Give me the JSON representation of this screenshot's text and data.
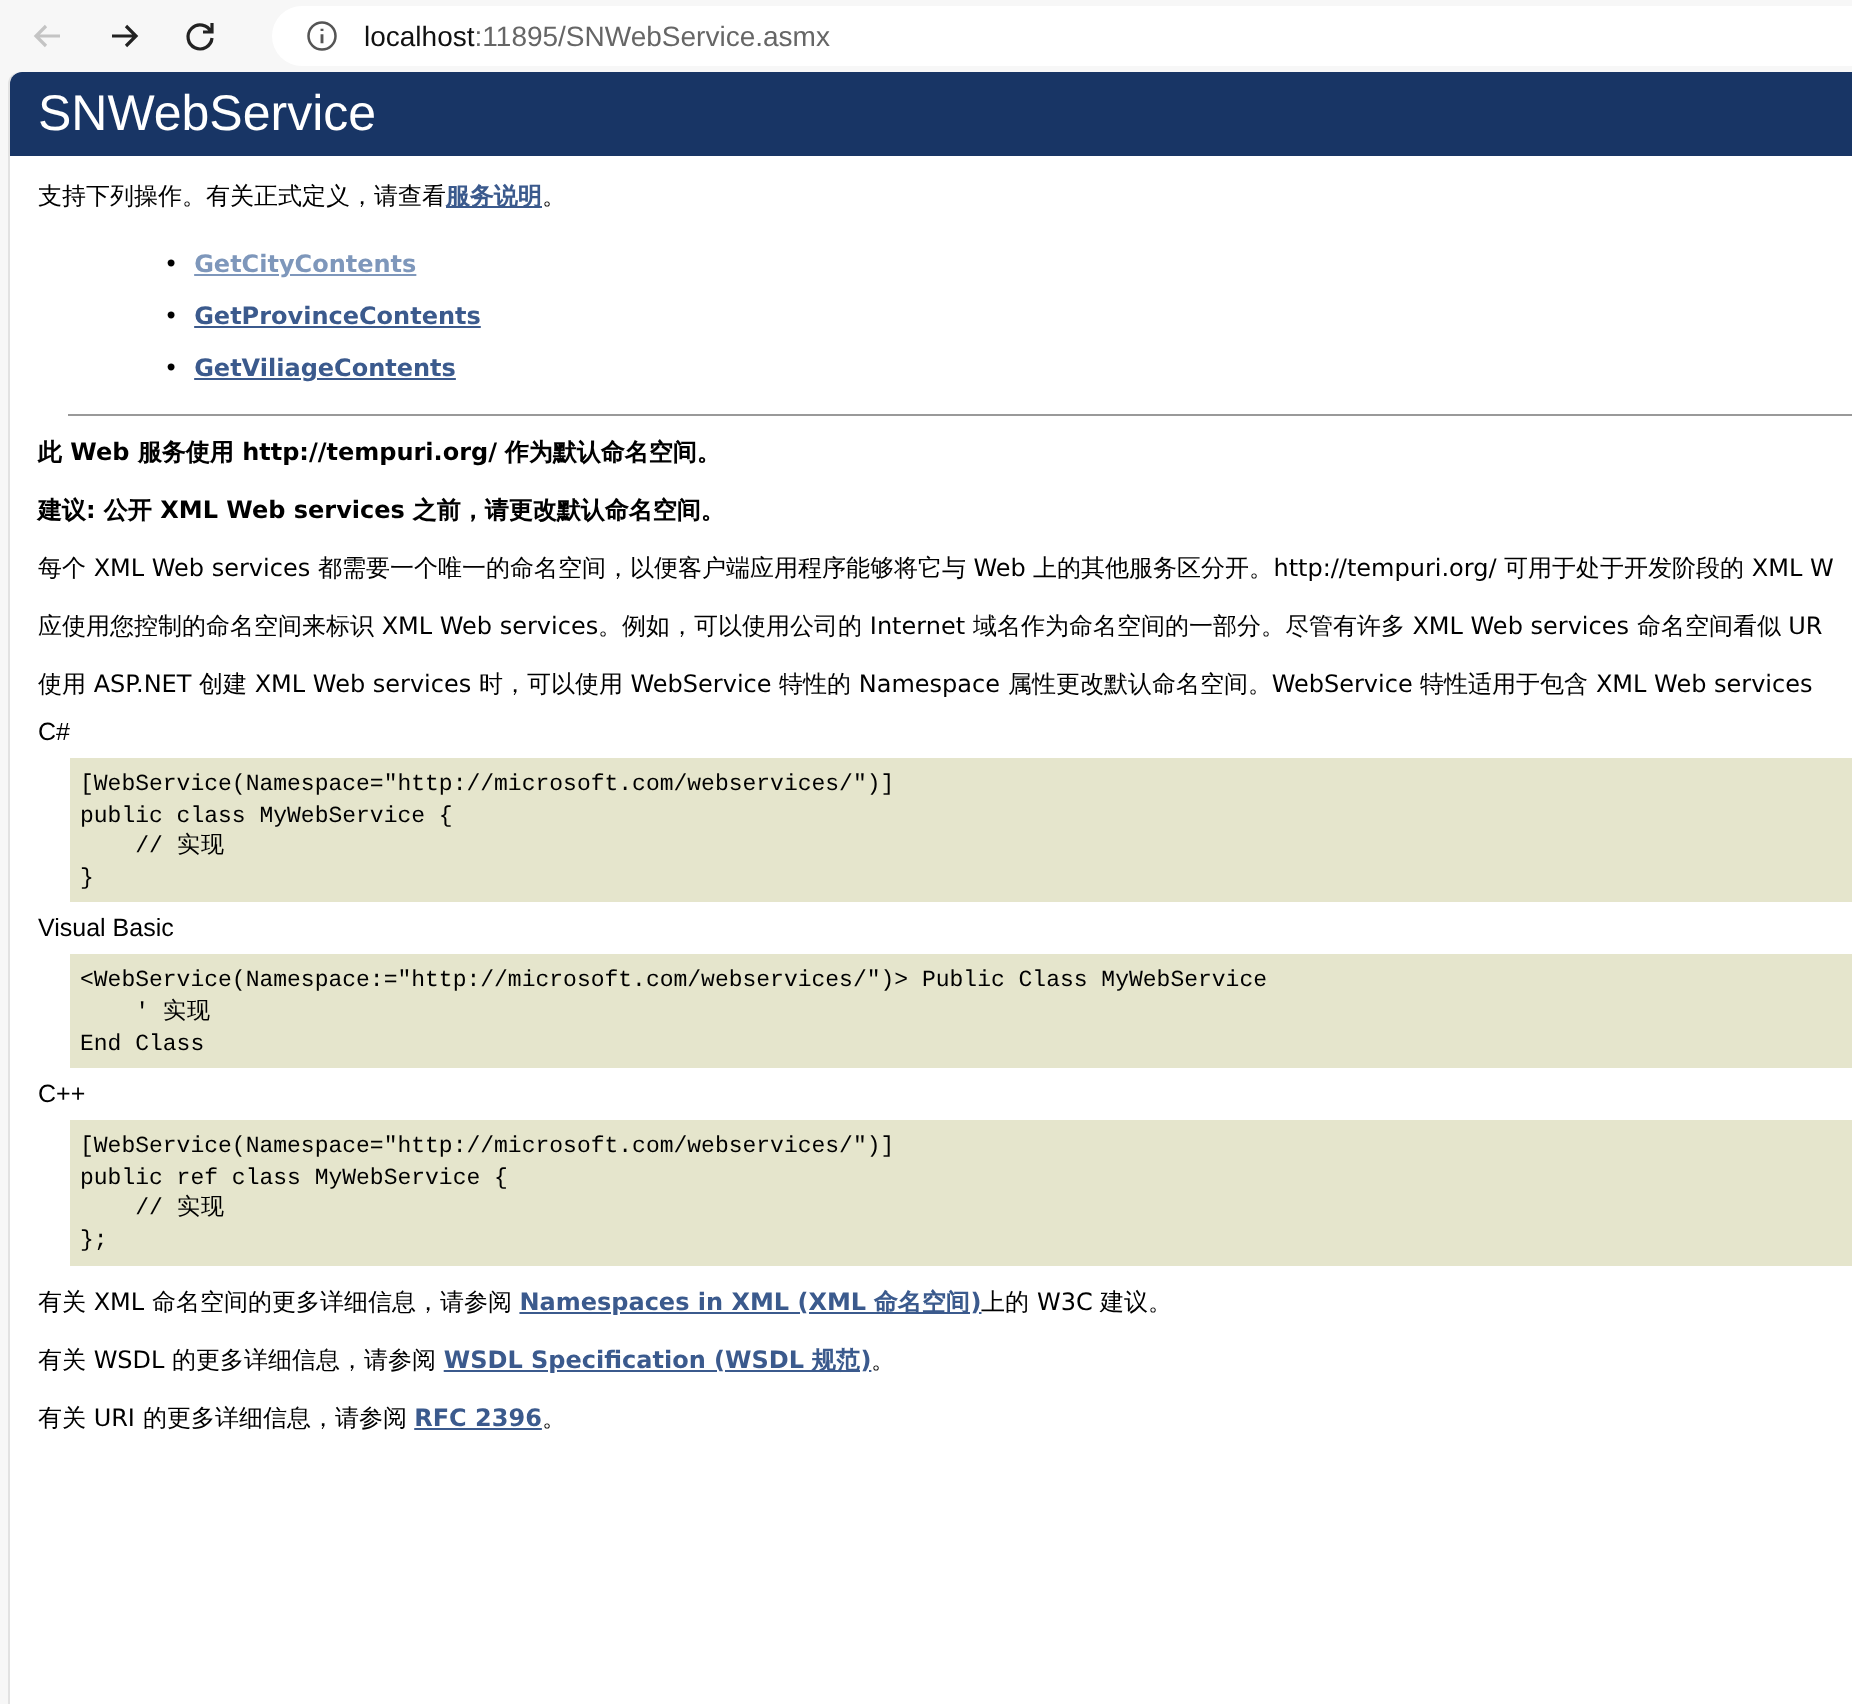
{
  "browser": {
    "back_disabled": true,
    "url": "localhost:11895/SNWebService.asmx"
  },
  "header": {
    "title": "SNWebService"
  },
  "intro": [
    {
      "text": "支持下列操作。有关正式定义，请查看"
    },
    {
      "text": "服务说明",
      "link": true
    },
    {
      "text": "。"
    }
  ],
  "operations": [
    {
      "bullet": "•",
      "label": "GetCityContents",
      "visited": true
    },
    {
      "bullet": "•",
      "label": "GetProvinceContents",
      "visited": false
    },
    {
      "bullet": "•",
      "label": "GetViliageContents",
      "visited": false
    }
  ],
  "notes": [
    {
      "kind": "bold",
      "text": "此 Web 服务使用 http://tempuri.org/ 作为默认命名空间。"
    },
    {
      "kind": "bold",
      "text": "建议: 公开 XML Web services 之前，请更改默认命名空间。"
    },
    {
      "kind": "plain",
      "text": "每个 XML Web services 都需要一个唯一的命名空间，以便客户端应用程序能够将它与 Web 上的其他服务区分开。http://tempuri.org/ 可用于处于开发阶段的 XML W"
    },
    {
      "kind": "plain",
      "text": "应使用您控制的命名空间来标识 XML Web services。例如，可以使用公司的 Internet 域名作为命名空间的一部分。尽管有许多 XML Web services 命名空间看似 UR"
    },
    {
      "kind": "plain",
      "text": "使用 ASP.NET 创建 XML Web services 时，可以使用 WebService 特性的 Namespace 属性更改默认命名空间。WebService 特性适用于包含 XML Web services"
    }
  ],
  "examples": [
    {
      "language": "C#",
      "code": [
        "[WebService(Namespace=\"http://microsoft.com/webservices/\")]",
        "public class MyWebService {",
        "    // 实现",
        "}"
      ]
    },
    {
      "language": "Visual Basic",
      "code": [
        "<WebService(Namespace:=\"http://microsoft.com/webservices/\")> Public Class MyWebService",
        "    ' 实现",
        "End Class"
      ]
    },
    {
      "language": "C++",
      "code": [
        "[WebService(Namespace=\"http://microsoft.com/webservices/\")]",
        "public ref class MyWebService {",
        "    // 实现",
        "};"
      ]
    }
  ],
  "references": [
    [
      {
        "text": "有关 XML 命名空间的更多详细信息，请参阅 "
      },
      {
        "text": "Namespaces in XML (XML 命名空间)",
        "link": true
      },
      {
        "text": "上的 W3C 建议。"
      }
    ],
    [
      {
        "text": "有关 WSDL 的更多详细信息，请参阅 "
      },
      {
        "text": "WSDL Specification (WSDL 规范)",
        "link": true
      },
      {
        "text": "。"
      }
    ],
    [
      {
        "text": "有关 URI 的更多详细信息，请参阅 "
      },
      {
        "text": "RFC 2396",
        "link": true
      },
      {
        "text": "。"
      }
    ]
  ]
}
